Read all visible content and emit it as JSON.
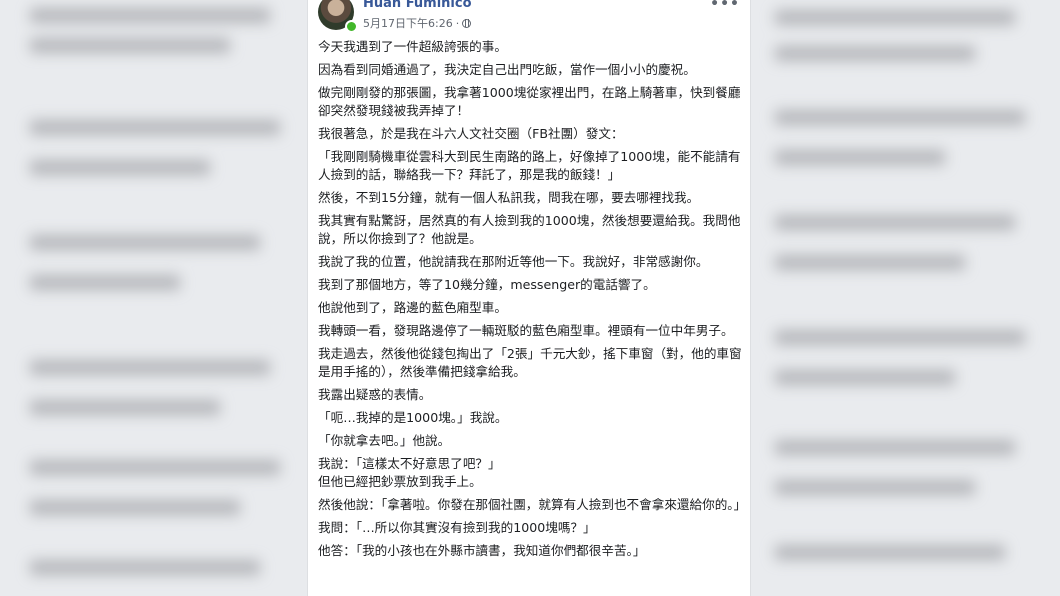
{
  "post": {
    "author": "Huān Fumihico",
    "timestamp": "5月17日下午6:26",
    "separator": "·",
    "privacy_icon": "globe-icon",
    "more_label": "•••",
    "avatar_icon": "avatar",
    "paragraphs": [
      "今天我遇到了一件超級誇張的事。",
      "因為看到同婚通過了，我決定自己出門吃飯，當作一個小小的慶祝。",
      "做完剛剛發的那張圖，我拿著1000塊從家裡出門，在路上騎著車，快到餐廳卻突然發現錢被我弄掉了！",
      "我很著急，於是我在斗六人文社交圈（FB社團）發文：",
      "「我剛剛騎機車從雲科大到民生南路的路上，好像掉了1000塊，能不能請有人撿到的話，聯絡我一下？拜託了，那是我的飯錢！」",
      "然後，不到15分鐘，就有一個人私訊我，問我在哪，要去哪裡找我。",
      "我其實有點驚訝，居然真的有人撿到我的1000塊，然後想要還給我。我問他說，所以你撿到了？他說是。",
      "我說了我的位置，他說請我在那附近等他一下。我說好，非常感謝你。",
      "我到了那個地方，等了10幾分鐘，messenger的電話響了。",
      "他說他到了，路邊的藍色廂型車。",
      "我轉頭一看，發現路邊停了一輛斑駁的藍色廂型車。裡頭有一位中年男子。",
      "我走過去，然後他從錢包掏出了「2張」千元大鈔，搖下車窗（對，他的車窗是用手搖的），然後準備把錢拿給我。",
      "我露出疑惑的表情。",
      "「呃…我掉的是1000塊。」我說。",
      "「你就拿去吧。」他說。",
      "我說：「這樣太不好意思了吧？」\n但他已經把鈔票放到我手上。",
      "然後他說：「拿著啦。你發在那個社團，就算有人撿到也不會拿來還給你的。」",
      "我問：「…所以你其實沒有撿到我的1000塊嗎？」",
      "他答：「我的小孩也在外縣市讀書，我知道你們都很辛苦。」"
    ]
  },
  "colors": {
    "page_bg": "#e9ebee",
    "card_bg": "#ffffff",
    "author": "#385898",
    "meta": "#616770",
    "text": "#1c1e21",
    "online": "#42b72a"
  }
}
